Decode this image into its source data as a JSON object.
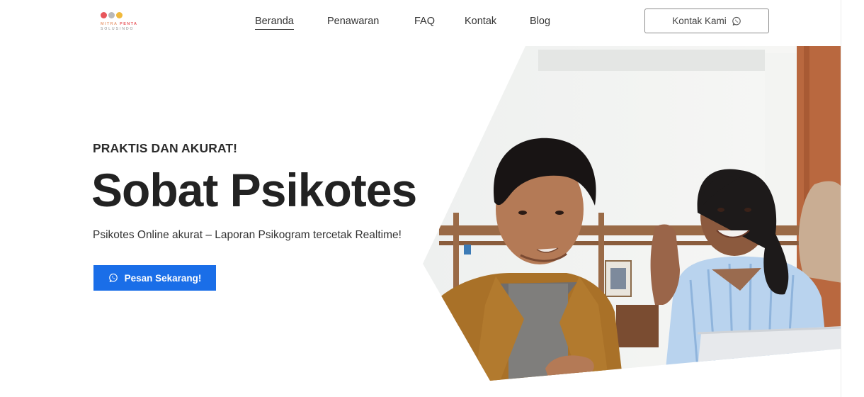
{
  "brand": {
    "line1_word1": "MITRA",
    "line1_word2": "PENTA",
    "line2": "SOLUSINDO",
    "dot_colors": [
      "#e8565b",
      "#b9b9b9",
      "#f0b93c"
    ]
  },
  "nav": {
    "items": [
      {
        "label": "Beranda",
        "active": true
      },
      {
        "label": "Penawaran",
        "active": false
      },
      {
        "label": "FAQ",
        "active": false
      },
      {
        "label": "Kontak",
        "active": false
      },
      {
        "label": "Blog",
        "active": false
      }
    ]
  },
  "header": {
    "contact_label": "Kontak Kami",
    "contact_icon": "whatsapp-icon"
  },
  "hero": {
    "eyebrow": "PRAKTIS DAN AKURAT!",
    "title": "Sobat Psikotes",
    "subtitle": "Psikotes Online akurat – Laporan Psikogram tercetak Realtime!",
    "cta_label": "Pesan Sekarang!",
    "cta_icon": "whatsapp-icon"
  },
  "colors": {
    "accent": "#1a6ee8",
    "text": "#222222"
  }
}
